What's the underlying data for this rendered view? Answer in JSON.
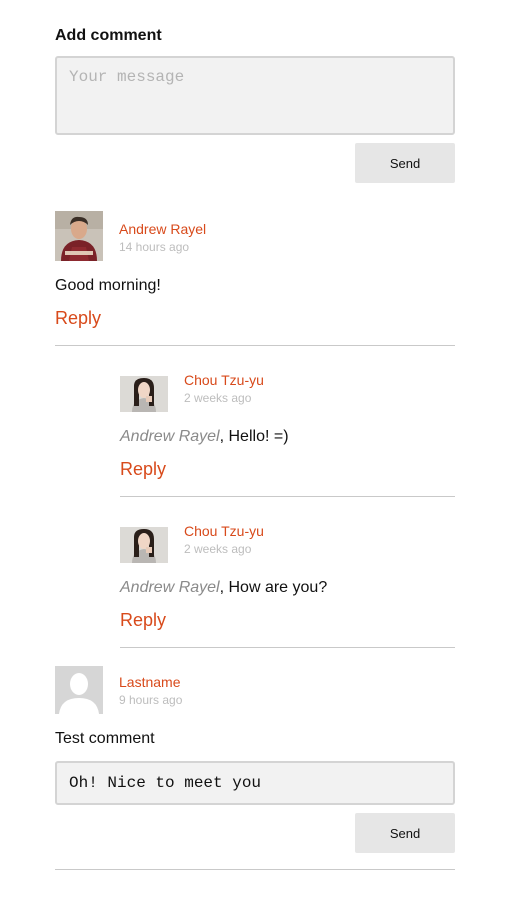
{
  "add_comment": {
    "title": "Add comment",
    "placeholder": "Your message",
    "send_label": "Send"
  },
  "comments": [
    {
      "author": "Andrew Rayel",
      "time": "14 hours ago",
      "text": "Good morning!",
      "reply_label": "Reply"
    },
    {
      "author": "Chou Tzu-yu",
      "time": "2 weeks ago",
      "mention": "Andrew Rayel",
      "text": ", Hello! =)",
      "reply_label": "Reply"
    },
    {
      "author": "Chou Tzu-yu",
      "time": "2 weeks ago",
      "mention": "Andrew Rayel",
      "text": ", How are you?",
      "reply_label": "Reply"
    },
    {
      "author": "Lastname",
      "time": "9 hours ago",
      "text": "Test comment"
    }
  ],
  "reply_form": {
    "value": "Oh! Nice to meet you",
    "send_label": "Send"
  }
}
